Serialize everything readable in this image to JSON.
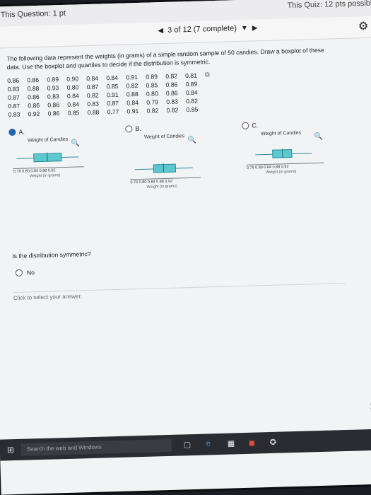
{
  "window": {
    "question_label": "This Question: 1 pt",
    "quiz_label": "This Quiz: 12 pts possible",
    "progress": "3 of 12 (7 complete)"
  },
  "question": {
    "prompt": "The following data represent the weights (in grams) of a simple random sample of 50 candies. Draw a boxplot of these data. Use the boxplot and quartiles to decide if the distribution is symmetric.",
    "data_rows": [
      [
        "0.86",
        "0.86",
        "0.89",
        "0.90",
        "0.84",
        "0.84",
        "0.91",
        "0.89",
        "0.82",
        "0.81"
      ],
      [
        "0.83",
        "0.88",
        "0.93",
        "0.80",
        "0.87",
        "0.85",
        "0.82",
        "0.85",
        "0.86",
        "0.89"
      ],
      [
        "0.87",
        "0.86",
        "0.83",
        "0.84",
        "0.82",
        "0.91",
        "0.88",
        "0.80",
        "0.86",
        "0.84"
      ],
      [
        "0.87",
        "0.86",
        "0.86",
        "0.84",
        "0.83",
        "0.87",
        "0.84",
        "0.79",
        "0.83",
        "0.82"
      ],
      [
        "0.83",
        "0.92",
        "0.86",
        "0.85",
        "0.88",
        "0.77",
        "0.91",
        "0.82",
        "0.82",
        "0.85"
      ]
    ],
    "copy_icon": "clipboard-icon",
    "options": [
      {
        "letter": "A.",
        "selected": true,
        "plot_title": "Weight of Candies",
        "ticks": "0.76 0.80 0.84 0.88 0.92",
        "axis_title": "Weight (in grams)"
      },
      {
        "letter": "B.",
        "selected": false,
        "plot_title": "Weight of Candies",
        "ticks": "0.76 0.80 0.84 0.88 0.92",
        "axis_title": "Weight (in grams)"
      },
      {
        "letter": "C.",
        "selected": false,
        "plot_title": "Weight of Candies",
        "ticks": "0.76 0.80 0.84 0.88 0.92",
        "axis_title": "Weight (in grams)"
      }
    ],
    "symmetric_question": "Is the distribution symmetric?",
    "answer_no": "No",
    "click_prompt": "Click to select your answer."
  },
  "taskbar": {
    "search_placeholder": "Search the web and Windows"
  },
  "colors": {
    "box_fill": "#5ec8d0",
    "box_border": "#2a8e96",
    "selected_radio": "#1e63b6"
  }
}
